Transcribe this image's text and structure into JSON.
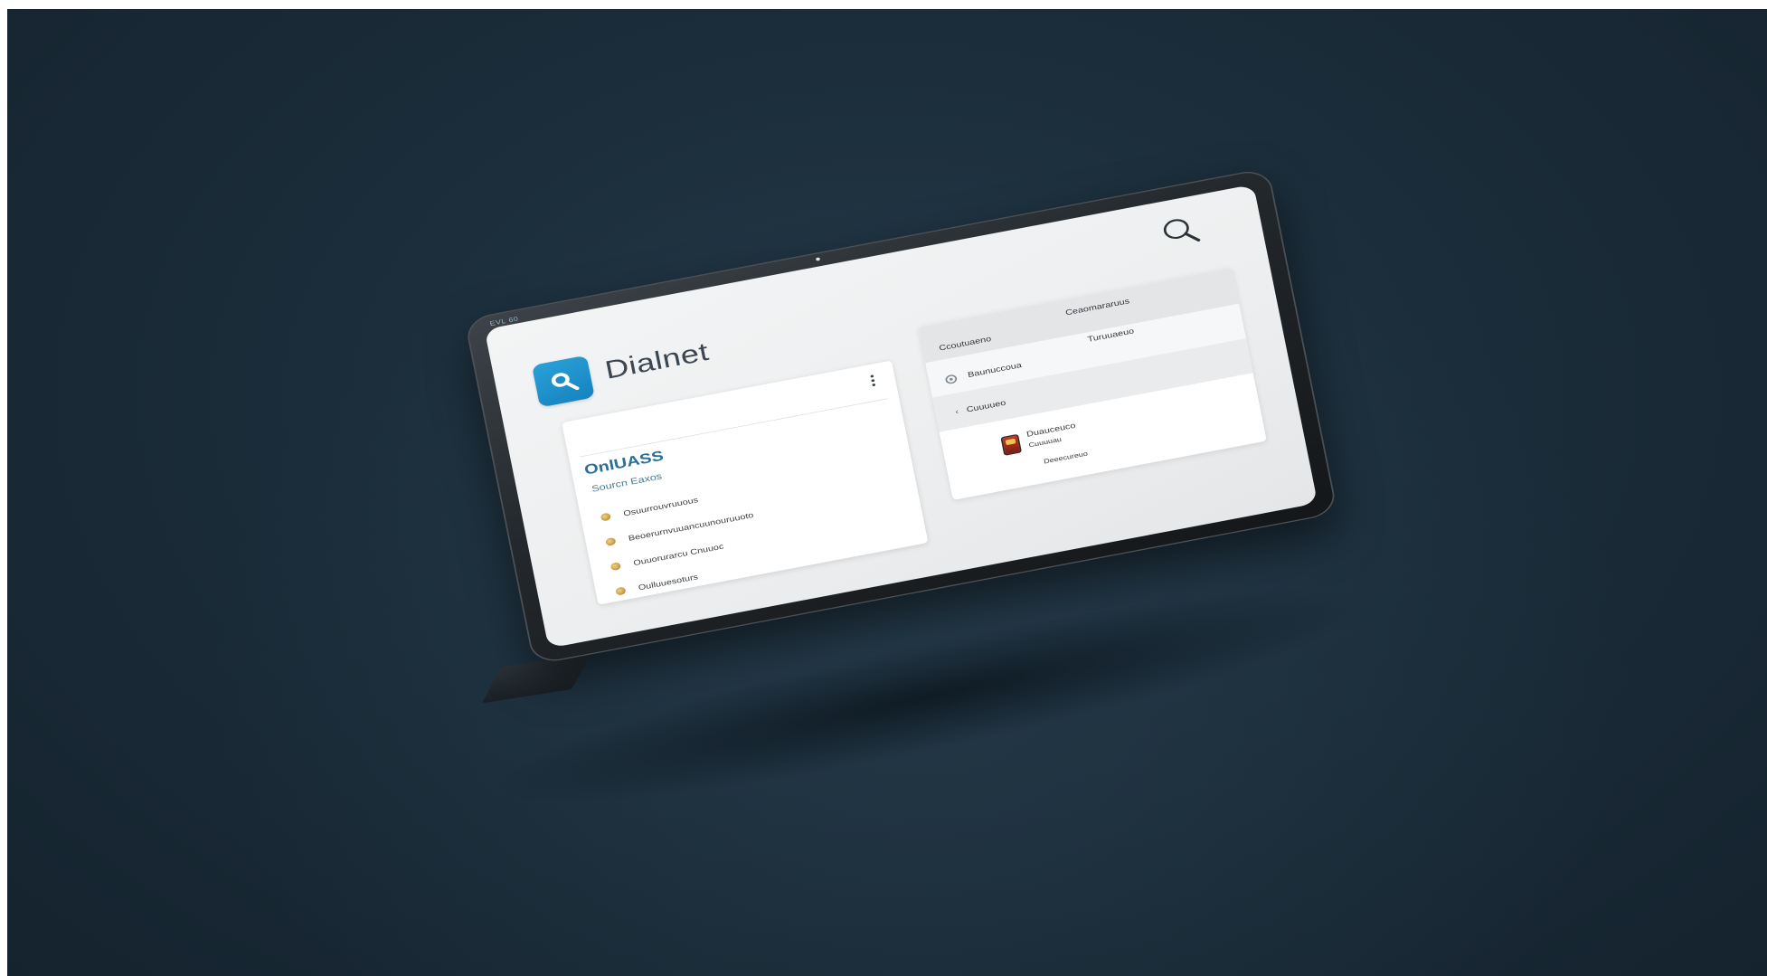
{
  "bezel": {
    "label": "EVL 60"
  },
  "app": {
    "name": "Dialnet"
  },
  "icons": {
    "logo": "search-icon",
    "search": "search-icon",
    "more": "more-vertical-icon",
    "radio": "radio-icon",
    "chevron": "chevron-left-icon",
    "thumbnail": "book-thumbnail-icon"
  },
  "colors": {
    "brand_blue": "#1e94cf",
    "title_blue": "#2b6f97",
    "background": "#1b2d3a",
    "screen": "#eef0f1"
  },
  "left_card": {
    "title": "OnlUASS",
    "subtitle": "Sourcn Eaxos",
    "items": [
      {
        "label": "Osuurrouvruuous"
      },
      {
        "label": "Beoerurnvuuancuunouruuoto"
      },
      {
        "label": "Ouuorurarcu Cnuuoc"
      },
      {
        "label": "Oulluuesoturs"
      }
    ]
  },
  "right_card": {
    "header": {
      "left": "Ccoutuaeno",
      "right": "Ceaomararuus"
    },
    "row_a": {
      "left": "Baunuccoua",
      "right": "Turuuaeuo"
    },
    "row_b": {
      "left": "Cuuuueo"
    },
    "row_c": {
      "title": "Duauceuco",
      "subtitle": "Cuuuuau",
      "footer": "Deeecureuo"
    }
  }
}
